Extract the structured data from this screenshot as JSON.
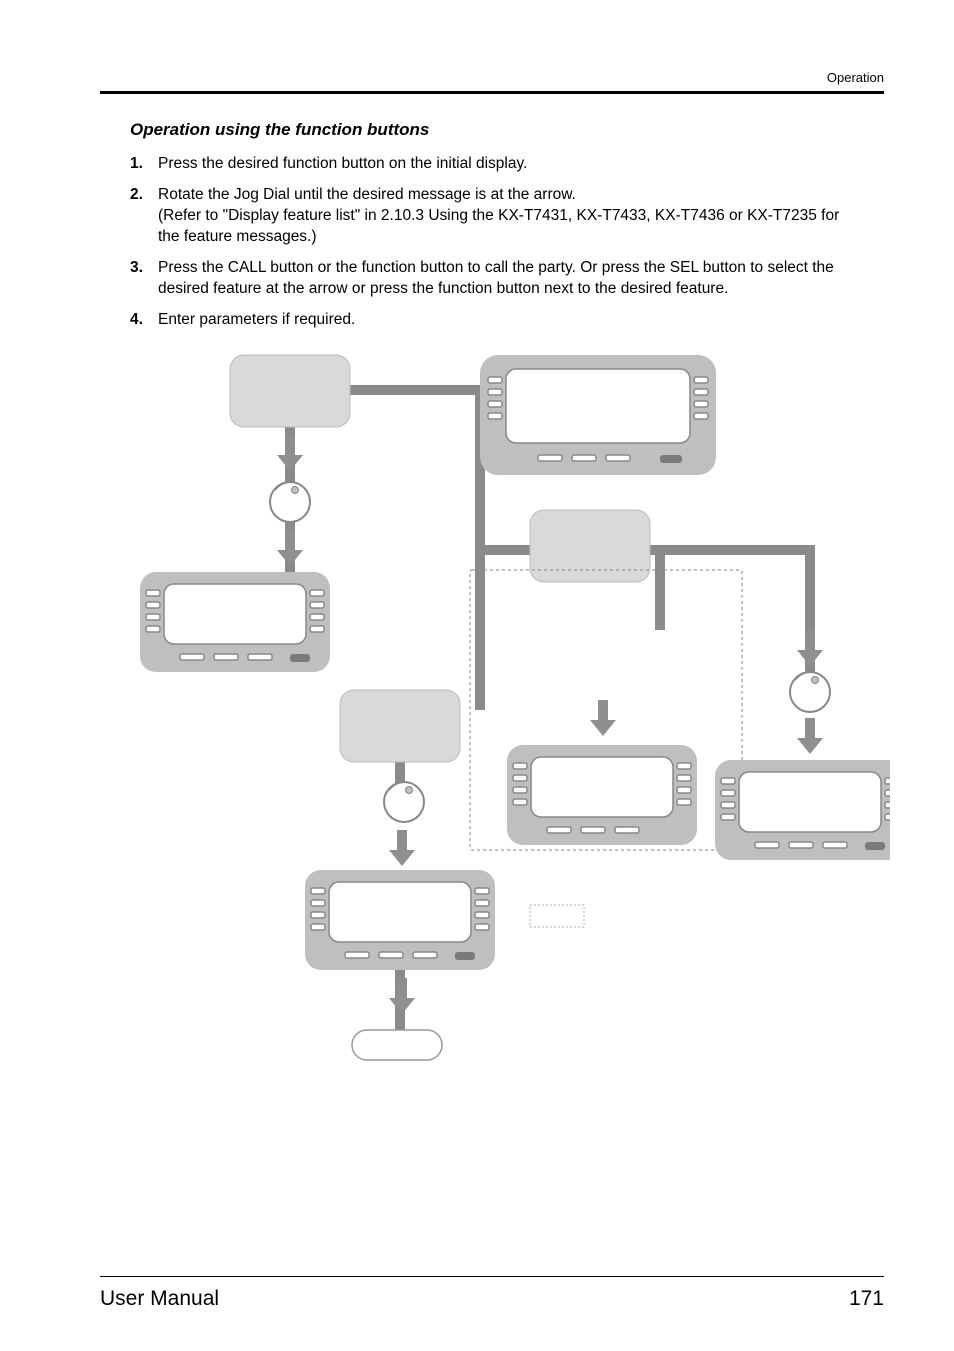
{
  "header": {
    "section": "Operation"
  },
  "subheading": "Operation using the function buttons",
  "steps": [
    {
      "n": "1.",
      "t": "Press the desired function button on the initial display."
    },
    {
      "n": "2.",
      "t": "Rotate the Jog Dial until the desired message is at the arrow.\n(Refer to \"Display feature list\" in 2.10.3    Using the KX-T7431, KX-T7433, KX-T7436 or KX-T7235 for the feature messages.)"
    },
    {
      "n": "3.",
      "t": "Press the CALL button or the function button to call the party. Or press the SEL button to select the desired feature at the arrow or press the function button next to the desired feature."
    },
    {
      "n": "4.",
      "t": "Enter parameters if required."
    }
  ],
  "footer": {
    "left": "User Manual",
    "right": "171"
  }
}
